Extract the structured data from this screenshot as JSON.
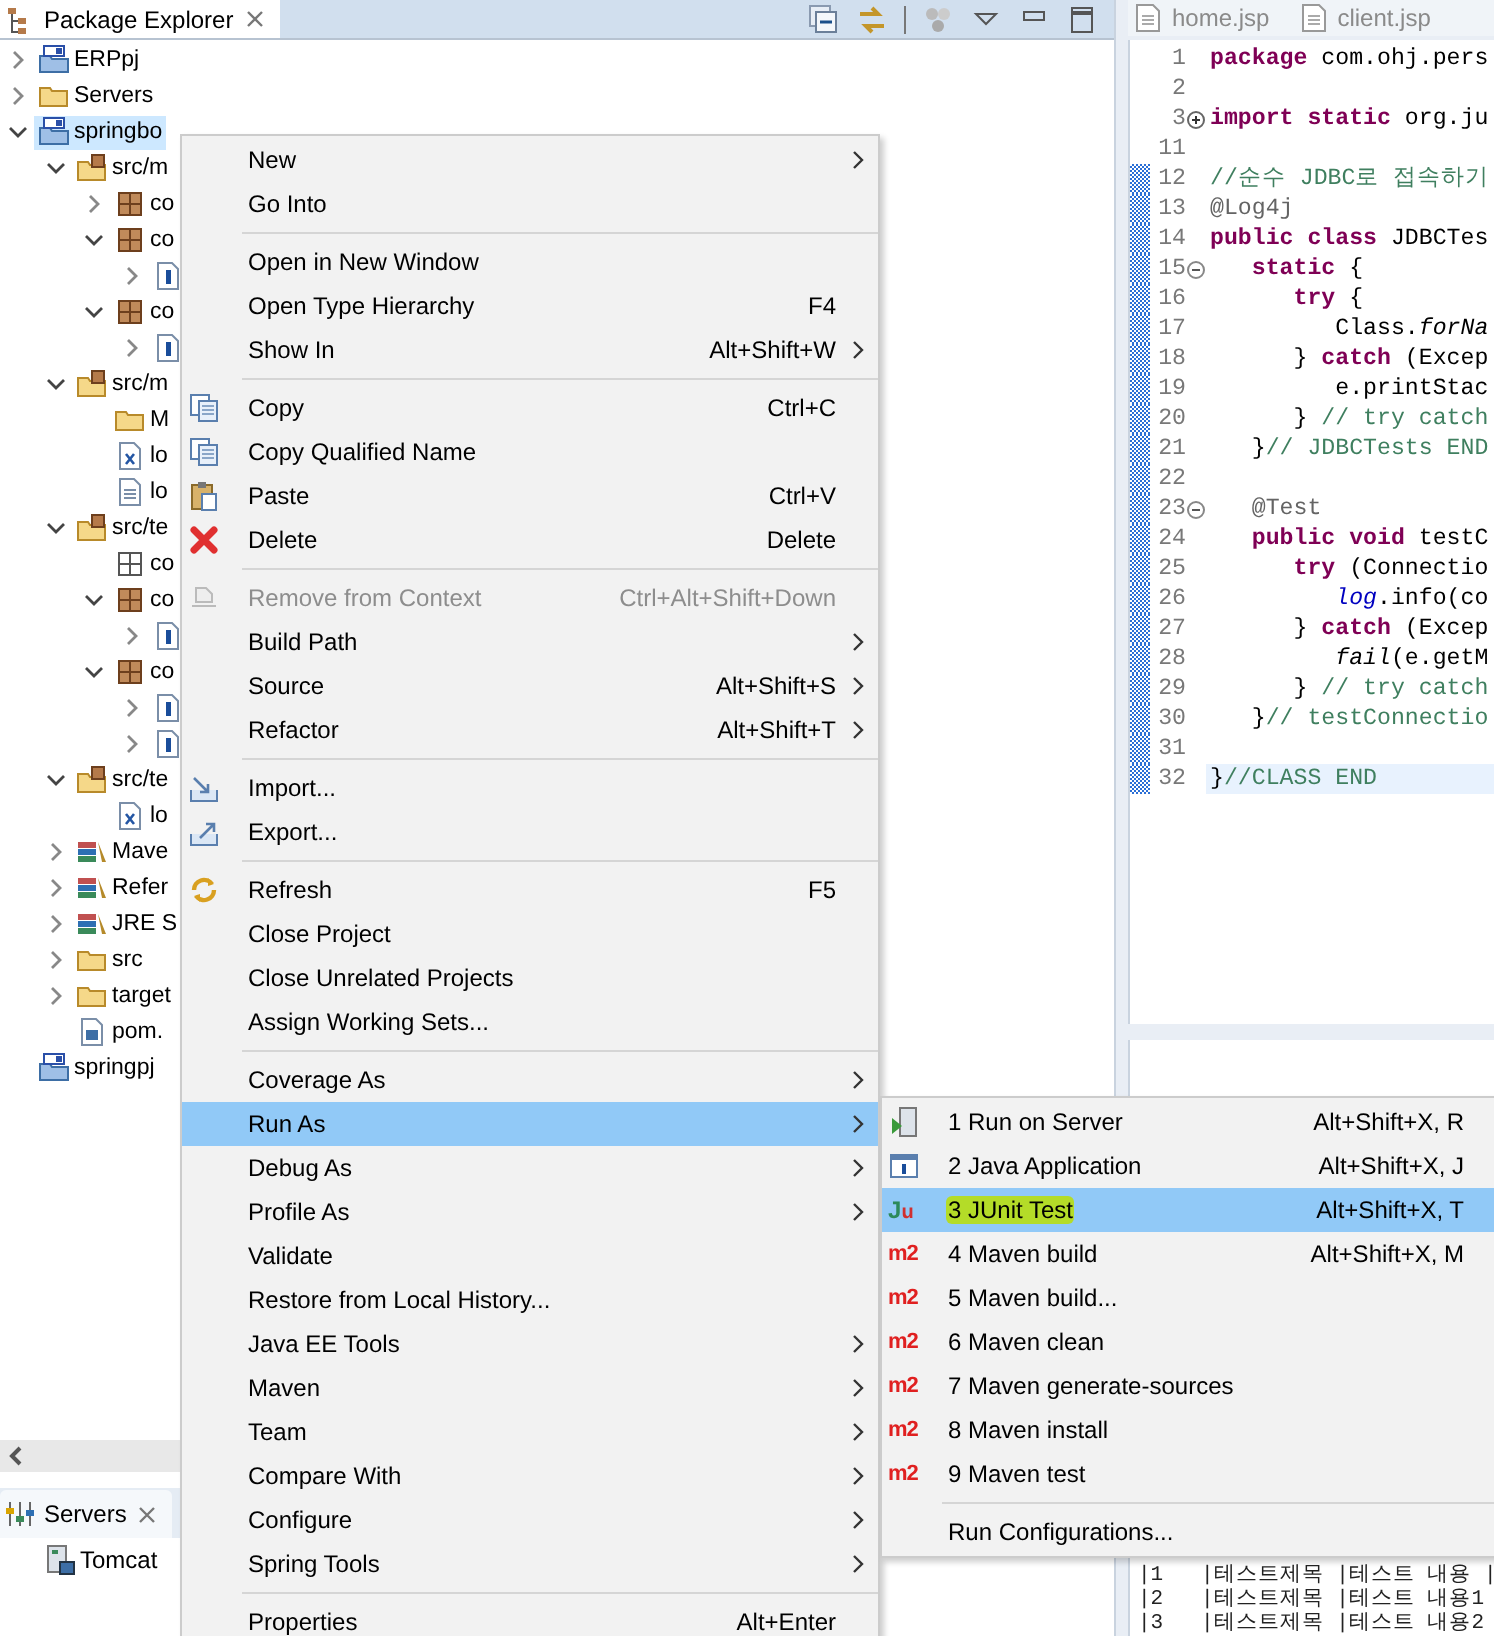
{
  "explorer": {
    "title": "Package Explorer",
    "tree": [
      {
        "label": "ERPpj",
        "kind": "project",
        "expanded": false,
        "selected": false
      },
      {
        "label": "Servers",
        "kind": "folder",
        "expanded": false,
        "selected": false
      },
      {
        "label": "springbo",
        "kind": "project",
        "expanded": true,
        "selected": true,
        "children": [
          {
            "label": "src/m",
            "kind": "source-folder",
            "expanded": true,
            "selected": false,
            "children": [
              {
                "label": "co",
                "kind": "package",
                "expanded": false,
                "selected": false
              },
              {
                "label": "co",
                "kind": "package",
                "expanded": true,
                "selected": false,
                "children": [
                  {
                    "kind": "java-file",
                    "expanded": false,
                    "selected": false
                  }
                ]
              },
              {
                "label": "co",
                "kind": "package",
                "expanded": true,
                "selected": false,
                "children": [
                  {
                    "kind": "java-file",
                    "expanded": false,
                    "selected": false
                  }
                ]
              }
            ]
          },
          {
            "label": "src/m",
            "kind": "source-folder",
            "expanded": true,
            "selected": false,
            "children": [
              {
                "label": "M",
                "kind": "folder",
                "selected": false
              },
              {
                "label": "lo",
                "kind": "xml-file",
                "selected": false
              },
              {
                "label": "lo",
                "kind": "text-file",
                "selected": false
              }
            ]
          },
          {
            "label": "src/te",
            "kind": "source-folder",
            "expanded": true,
            "selected": false,
            "children": [
              {
                "label": "co",
                "kind": "package-empty",
                "selected": false
              },
              {
                "label": "co",
                "kind": "package",
                "expanded": true,
                "selected": false,
                "children": [
                  {
                    "kind": "java-file",
                    "expanded": false,
                    "selected": false
                  }
                ]
              },
              {
                "label": "co",
                "kind": "package",
                "expanded": true,
                "selected": false,
                "children": [
                  {
                    "kind": "java-file",
                    "expanded": false,
                    "selected": false
                  },
                  {
                    "kind": "java-file",
                    "expanded": false,
                    "selected": false
                  }
                ]
              }
            ]
          },
          {
            "label": "src/te",
            "kind": "source-folder",
            "expanded": true,
            "selected": false,
            "children": [
              {
                "label": "lo",
                "kind": "xml-file",
                "selected": false
              }
            ]
          },
          {
            "label": "Mave",
            "kind": "library",
            "expanded": false,
            "selected": false
          },
          {
            "label": "Refer",
            "kind": "library",
            "expanded": false,
            "selected": false
          },
          {
            "label": "JRE S",
            "kind": "library",
            "expanded": false,
            "selected": false
          },
          {
            "label": "src",
            "kind": "folder",
            "expanded": false,
            "selected": false
          },
          {
            "label": "target",
            "kind": "folder",
            "expanded": false,
            "selected": false
          },
          {
            "label": "pom.",
            "kind": "pom-file",
            "selected": false
          }
        ]
      },
      {
        "label": "springpj",
        "kind": "project",
        "selected": false
      }
    ]
  },
  "servers_view": {
    "title": "Servers",
    "items": [
      {
        "label": "Tomcat"
      }
    ]
  },
  "editor": {
    "tabs": [
      {
        "label": "home.jsp"
      },
      {
        "label": "client.jsp"
      }
    ],
    "lines": [
      {
        "number": "1",
        "changed": false,
        "current": false,
        "tokens": [
          {
            "kind": "keyword",
            "text": "package"
          },
          {
            "kind": "plain",
            "text": " com.ohj.pers"
          }
        ]
      },
      {
        "number": "2",
        "changed": false,
        "current": false
      },
      {
        "number": "3",
        "collapsed": true,
        "changed": false,
        "current": false,
        "tokens": [
          {
            "kind": "keyword",
            "text": "import static"
          },
          {
            "kind": "plain",
            "text": " org.ju"
          }
        ]
      },
      {
        "number": "11",
        "changed": false,
        "current": false
      },
      {
        "number": "12",
        "changed": true,
        "current": false,
        "tokens": [
          {
            "kind": "comment",
            "text": "//순수 JDBC로 접속하기"
          }
        ]
      },
      {
        "number": "13",
        "changed": true,
        "current": false,
        "tokens": [
          {
            "kind": "annotation",
            "text": "@Log4j"
          }
        ]
      },
      {
        "number": "14",
        "changed": true,
        "current": false,
        "tokens": [
          {
            "kind": "keyword",
            "text": "public class"
          },
          {
            "kind": "plain",
            "text": " JDBCTes"
          }
        ]
      },
      {
        "number": "15",
        "collapsed": false,
        "changed": true,
        "current": false,
        "tokens": [
          {
            "kind": "keyword",
            "text": "   static"
          },
          {
            "kind": "plain",
            "text": " {"
          }
        ]
      },
      {
        "number": "16",
        "changed": true,
        "current": false,
        "tokens": [
          {
            "kind": "keyword",
            "text": "      try"
          },
          {
            "kind": "plain",
            "text": " {"
          }
        ]
      },
      {
        "number": "17",
        "changed": true,
        "current": false,
        "tokens": [
          {
            "kind": "plain",
            "text": "         Class."
          },
          {
            "kind": "static",
            "text": "forNa"
          }
        ]
      },
      {
        "number": "18",
        "changed": true,
        "current": false,
        "tokens": [
          {
            "kind": "plain",
            "text": "      } "
          },
          {
            "kind": "keyword",
            "text": "catch"
          },
          {
            "kind": "plain",
            "text": " (Excep"
          }
        ]
      },
      {
        "number": "19",
        "changed": true,
        "current": false,
        "tokens": [
          {
            "kind": "plain",
            "text": "         e.printStac"
          }
        ]
      },
      {
        "number": "20",
        "changed": true,
        "current": false,
        "tokens": [
          {
            "kind": "plain",
            "text": "      } "
          },
          {
            "kind": "comment",
            "text": "// try catch"
          }
        ]
      },
      {
        "number": "21",
        "changed": true,
        "current": false,
        "tokens": [
          {
            "kind": "plain",
            "text": "   }"
          },
          {
            "kind": "comment",
            "text": "// JDBCTests END"
          }
        ]
      },
      {
        "number": "22",
        "changed": true,
        "current": false
      },
      {
        "number": "23",
        "collapsed": false,
        "changed": true,
        "current": false,
        "tokens": [
          {
            "kind": "annotation",
            "text": "   @Test"
          }
        ]
      },
      {
        "number": "24",
        "changed": true,
        "current": false,
        "tokens": [
          {
            "kind": "keyword",
            "text": "   public void"
          },
          {
            "kind": "plain",
            "text": " testC"
          }
        ]
      },
      {
        "number": "25",
        "changed": true,
        "current": false,
        "tokens": [
          {
            "kind": "keyword",
            "text": "      try"
          },
          {
            "kind": "plain",
            "text": " (Connectio"
          }
        ]
      },
      {
        "number": "26",
        "changed": true,
        "current": false,
        "tokens": [
          {
            "kind": "field",
            "text": "         log"
          },
          {
            "kind": "plain",
            "text": ".info(co"
          }
        ]
      },
      {
        "number": "27",
        "changed": true,
        "current": false,
        "tokens": [
          {
            "kind": "plain",
            "text": "      } "
          },
          {
            "kind": "keyword",
            "text": "catch"
          },
          {
            "kind": "plain",
            "text": " (Excep"
          }
        ]
      },
      {
        "number": "28",
        "changed": true,
        "current": false,
        "tokens": [
          {
            "kind": "static",
            "text": "         fail"
          },
          {
            "kind": "plain",
            "text": "(e.getM"
          }
        ]
      },
      {
        "number": "29",
        "changed": true,
        "current": false,
        "tokens": [
          {
            "kind": "plain",
            "text": "      } "
          },
          {
            "kind": "comment",
            "text": "// try catch"
          }
        ]
      },
      {
        "number": "30",
        "changed": true,
        "current": false,
        "tokens": [
          {
            "kind": "plain",
            "text": "   }"
          },
          {
            "kind": "comment",
            "text": "// testConnectio"
          }
        ]
      },
      {
        "number": "31",
        "changed": true,
        "current": false
      },
      {
        "number": "32",
        "changed": true,
        "current": true,
        "tokens": [
          {
            "kind": "plain",
            "text": "}"
          },
          {
            "kind": "comment",
            "text": "//CLASS END"
          }
        ]
      }
    ]
  },
  "console": {
    "lines": [
      "|1   |테스트제목 |테스트 내용 |",
      "|2   |테스트제목 |테스트 내용1",
      "|3   |테스트제목 |테스트 내용2"
    ]
  },
  "context_menu": {
    "items": [
      {
        "kind": "plain",
        "label": "New",
        "submenu": true,
        "disabled": false,
        "selected": false
      },
      {
        "kind": "plain",
        "label": "Go Into",
        "submenu": false,
        "disabled": false,
        "selected": false
      },
      {
        "kind": "separator"
      },
      {
        "kind": "plain",
        "label": "Open in New Window",
        "submenu": false,
        "disabled": false,
        "selected": false
      },
      {
        "kind": "plain",
        "label": "Open Type Hierarchy",
        "shortcut": "F4",
        "submenu": false,
        "disabled": false,
        "selected": false
      },
      {
        "kind": "plain",
        "label": "Show In",
        "shortcut": "Alt+Shift+W",
        "submenu": true,
        "disabled": false,
        "selected": false
      },
      {
        "kind": "separator"
      },
      {
        "kind": "copy",
        "label": "Copy",
        "shortcut": "Ctrl+C",
        "submenu": false,
        "disabled": false,
        "selected": false
      },
      {
        "kind": "copy",
        "label": "Copy Qualified Name",
        "submenu": false,
        "disabled": false,
        "selected": false
      },
      {
        "kind": "paste",
        "label": "Paste",
        "shortcut": "Ctrl+V",
        "submenu": false,
        "disabled": false,
        "selected": false
      },
      {
        "kind": "delete",
        "label": "Delete",
        "shortcut": "Delete",
        "submenu": false,
        "disabled": false,
        "selected": false
      },
      {
        "kind": "separator"
      },
      {
        "kind": "remove",
        "label": "Remove from Context",
        "shortcut": "Ctrl+Alt+Shift+Down",
        "submenu": false,
        "disabled": true,
        "selected": false
      },
      {
        "kind": "plain",
        "label": "Build Path",
        "submenu": true,
        "disabled": false,
        "selected": false
      },
      {
        "kind": "plain",
        "label": "Source",
        "shortcut": "Alt+Shift+S",
        "submenu": true,
        "disabled": false,
        "selected": false
      },
      {
        "kind": "plain",
        "label": "Refactor",
        "shortcut": "Alt+Shift+T",
        "submenu": true,
        "disabled": false,
        "selected": false
      },
      {
        "kind": "separator"
      },
      {
        "kind": "import",
        "label": "Import...",
        "submenu": false,
        "disabled": false,
        "selected": false
      },
      {
        "kind": "export",
        "label": "Export...",
        "submenu": false,
        "disabled": false,
        "selected": false
      },
      {
        "kind": "separator"
      },
      {
        "kind": "refresh",
        "label": "Refresh",
        "shortcut": "F5",
        "submenu": false,
        "disabled": false,
        "selected": false
      },
      {
        "kind": "plain",
        "label": "Close Project",
        "submenu": false,
        "disabled": false,
        "selected": false
      },
      {
        "kind": "plain",
        "label": "Close Unrelated Projects",
        "submenu": false,
        "disabled": false,
        "selected": false
      },
      {
        "kind": "plain",
        "label": "Assign Working Sets...",
        "submenu": false,
        "disabled": false,
        "selected": false
      },
      {
        "kind": "separator"
      },
      {
        "kind": "plain",
        "label": "Coverage As",
        "submenu": true,
        "disabled": false,
        "selected": false
      },
      {
        "kind": "plain",
        "label": "Run As",
        "submenu": true,
        "disabled": false,
        "selected": true
      },
      {
        "kind": "plain",
        "label": "Debug As",
        "submenu": true,
        "disabled": false,
        "selected": false
      },
      {
        "kind": "plain",
        "label": "Profile As",
        "submenu": true,
        "disabled": false,
        "selected": false
      },
      {
        "kind": "plain",
        "label": "Validate",
        "submenu": false,
        "disabled": false,
        "selected": false
      },
      {
        "kind": "plain",
        "label": "Restore from Local History...",
        "submenu": false,
        "disabled": false,
        "selected": false
      },
      {
        "kind": "plain",
        "label": "Java EE Tools",
        "submenu": true,
        "disabled": false,
        "selected": false
      },
      {
        "kind": "plain",
        "label": "Maven",
        "submenu": true,
        "disabled": false,
        "selected": false
      },
      {
        "kind": "plain",
        "label": "Team",
        "submenu": true,
        "disabled": false,
        "selected": false
      },
      {
        "kind": "plain",
        "label": "Compare With",
        "submenu": true,
        "disabled": false,
        "selected": false
      },
      {
        "kind": "plain",
        "label": "Configure",
        "submenu": true,
        "disabled": false,
        "selected": false
      },
      {
        "kind": "plain",
        "label": "Spring Tools",
        "submenu": true,
        "disabled": false,
        "selected": false
      },
      {
        "kind": "separator"
      },
      {
        "kind": "plain",
        "label": "Properties",
        "shortcut": "Alt+Enter",
        "submenu": false,
        "disabled": false,
        "selected": false
      }
    ]
  },
  "run_as_menu": {
    "items": [
      {
        "kind": "server",
        "label": "1 Run on Server",
        "shortcut": "Alt+Shift+X, R",
        "selected": false,
        "marked": false
      },
      {
        "kind": "java-app",
        "label": "2 Java Application",
        "shortcut": "Alt+Shift+X, J",
        "selected": false,
        "marked": false
      },
      {
        "kind": "junit",
        "label": "3 JUnit Test",
        "shortcut": "Alt+Shift+X, T",
        "icon_text": "Ju",
        "selected": true,
        "marked": true
      },
      {
        "kind": "m2",
        "label": "4 Maven build",
        "shortcut": "Alt+Shift+X, M",
        "icon_text": "m2",
        "selected": false,
        "marked": false
      },
      {
        "kind": "m2",
        "label": "5 Maven build...",
        "icon_text": "m2",
        "selected": false,
        "marked": false
      },
      {
        "kind": "m2",
        "label": "6 Maven clean",
        "icon_text": "m2",
        "selected": false,
        "marked": false
      },
      {
        "kind": "m2",
        "label": "7 Maven generate-sources",
        "icon_text": "m2",
        "selected": false,
        "marked": false
      },
      {
        "kind": "m2",
        "label": "8 Maven install",
        "icon_text": "m2",
        "selected": false,
        "marked": false
      },
      {
        "kind": "m2",
        "label": "9 Maven test",
        "icon_text": "m2",
        "selected": false,
        "marked": false
      },
      {
        "kind": "separator"
      },
      {
        "kind": "plain",
        "label": "Run Configurations...",
        "selected": false,
        "marked": false
      }
    ]
  }
}
